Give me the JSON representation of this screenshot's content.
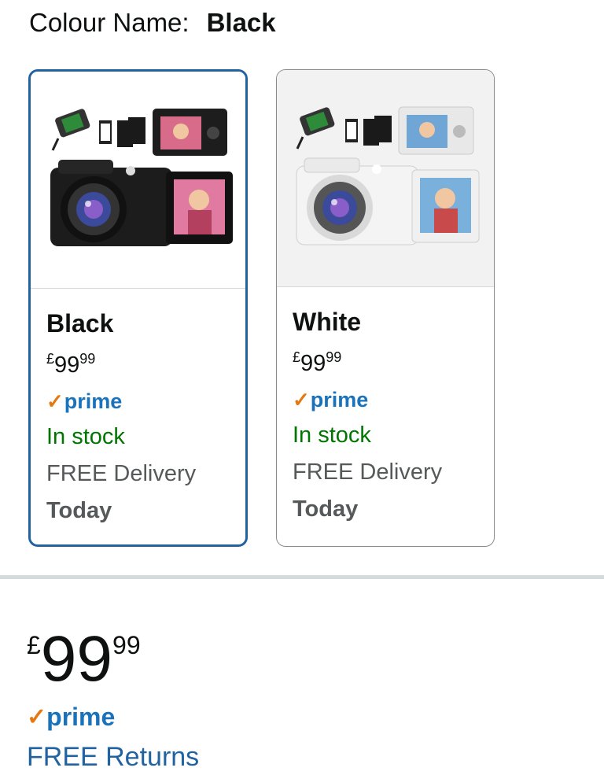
{
  "colour": {
    "label": "Colour Name:",
    "value": "Black"
  },
  "options": [
    {
      "name": "Black",
      "price_currency": "£",
      "price_whole": "99",
      "price_fraction": "99",
      "prime": "prime",
      "stock": "In stock",
      "delivery": "FREE Delivery",
      "delivery_day": "Today",
      "selected": true
    },
    {
      "name": "White",
      "price_currency": "£",
      "price_whole": "99",
      "price_fraction": "99",
      "prime": "prime",
      "stock": "In stock",
      "delivery": "FREE Delivery",
      "delivery_day": "Today",
      "selected": false
    }
  ],
  "main_price": {
    "currency": "£",
    "whole": "99",
    "fraction": "99"
  },
  "prime_badge": "prime",
  "returns": "FREE Returns",
  "colors": {
    "selected_border": "#2162a1",
    "prime_blue": "#1a72ba",
    "prime_tick": "#e47911",
    "stock_green": "#007600"
  },
  "images": [
    "black-camera-bundle-image",
    "white-camera-bundle-image"
  ]
}
